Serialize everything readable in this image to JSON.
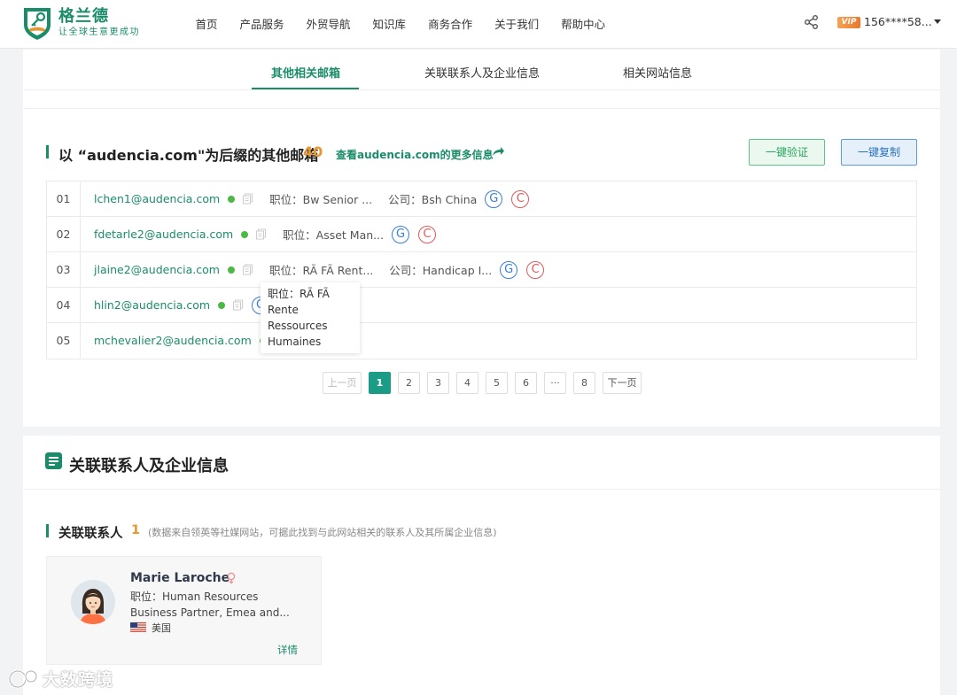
{
  "header": {
    "logo_title": "格兰德",
    "logo_slogan": "让全球生意更成功",
    "nav": [
      "首页",
      "产品服务",
      "外贸导航",
      "知识库",
      "商务合作",
      "关于我们",
      "帮助中心"
    ],
    "vip_label": "VIP",
    "user_phone": "156****58..."
  },
  "tabs": {
    "items": [
      "其他相关邮箱",
      "关联联系人及企业信息",
      "相关网站信息"
    ],
    "active": 0
  },
  "emails_section": {
    "title": "以 “audencia.com\"为后缀的其他邮箱",
    "count": "40",
    "more_link": "查看audencia.com的更多信息",
    "verify_button": "一键验证",
    "copy_button": "一键复制",
    "rows": [
      {
        "no": "01",
        "email": "lchen1@audencia.com",
        "position": "职位：Bw Senior ...",
        "company": "公司：Bsh China"
      },
      {
        "no": "02",
        "email": "fdetarle2@audencia.com",
        "position": "职位：Asset Man...",
        "company": ""
      },
      {
        "no": "03",
        "email": "jlaine2@audencia.com",
        "position": "职位：RÃ FÃ Rent...",
        "company": "公司：Handicap I..."
      },
      {
        "no": "04",
        "email": "hlin2@audencia.com",
        "position": "",
        "company": ""
      },
      {
        "no": "05",
        "email": "mchevalier2@audencia.com",
        "position": "",
        "company": ""
      }
    ],
    "badge_g": "G",
    "badge_c": "C",
    "tooltip": "职位：RÃ FÃ Rente Ressources Humaines",
    "pagination": {
      "prev": "上一页",
      "pages": [
        "1",
        "2",
        "3",
        "4",
        "5",
        "6",
        "···",
        "8"
      ],
      "next": "下一页",
      "current": "1"
    }
  },
  "related_section": {
    "title": "关联联系人及企业信息",
    "sub_title": "关联联系人",
    "count": "1",
    "note": "(数据来自领英等社媒网站，可据此找到与此网站相关的联系人及其所属企业信息)",
    "contact": {
      "name": "Marie Laroche",
      "position": "职位：Human Resources Business Partner, Emea and...",
      "country": "美国",
      "detail": "详情"
    }
  },
  "watermark": "大数跨境",
  "colors": {
    "brand": "#1b8c6a",
    "accent": "#e8962f",
    "online": "#4cb944",
    "g_badge": "#3a7fd5",
    "c_badge": "#e05a5a"
  }
}
